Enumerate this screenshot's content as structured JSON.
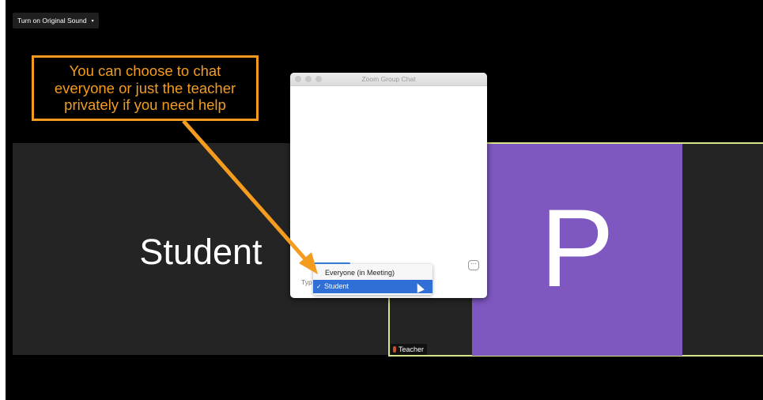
{
  "toolbar": {
    "original_sound_label": "Turn on Original Sound",
    "caret": "▾"
  },
  "student_tile": {
    "name": "Student"
  },
  "teacher_tile": {
    "avatar_letter": "P",
    "label": "Teacher"
  },
  "chat": {
    "title": "Zoom Group Chat",
    "more_label": "···",
    "type_prefix": "Typ",
    "dropdown": {
      "options": [
        "Everyone (in Meeting)",
        "Student"
      ],
      "selected": "Student",
      "check": "✓"
    }
  },
  "callout": {
    "lines": [
      "You can choose to chat",
      "everyone or just the teacher",
      "privately if you need help"
    ]
  },
  "colors": {
    "accent": "#f39c1f",
    "avatar": "#7e58c0",
    "selection": "#2f6fd6",
    "speaker_border": "#d7e48a"
  }
}
